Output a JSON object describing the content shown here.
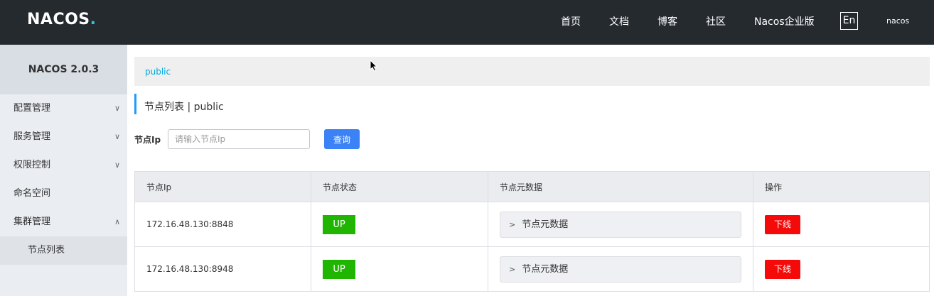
{
  "header": {
    "logo": "NACOS",
    "logo_dot": ".",
    "nav": [
      "首页",
      "文档",
      "博客",
      "社区",
      "Nacos企业版"
    ],
    "lang": "En",
    "user": "nacos"
  },
  "sidebar": {
    "title": "NACOS 2.0.3",
    "items": [
      {
        "label": "配置管理",
        "chevron": "∨"
      },
      {
        "label": "服务管理",
        "chevron": "∨"
      },
      {
        "label": "权限控制",
        "chevron": "∨"
      },
      {
        "label": "命名空间",
        "chevron": ""
      },
      {
        "label": "集群管理",
        "chevron": "∧"
      }
    ],
    "sub_items": [
      {
        "label": "节点列表"
      }
    ]
  },
  "breadcrumb": {
    "namespace": "public"
  },
  "page": {
    "title": "节点列表  |  public"
  },
  "search": {
    "label": "节点Ip",
    "placeholder": "请输入节点Ip",
    "value": "",
    "button": "查询"
  },
  "table": {
    "headers": [
      "节点Ip",
      "节点状态",
      "节点元数据",
      "操作"
    ],
    "rows": [
      {
        "ip": "172.16.48.130:8848",
        "status": "UP",
        "meta": "节点元数据",
        "action": "下线"
      },
      {
        "ip": "172.16.48.130:8948",
        "status": "UP",
        "meta": "节点元数据",
        "action": "下线"
      }
    ]
  },
  "colors": {
    "topbar": "#252a2f",
    "accent": "#209bfa",
    "up": "#1fb500",
    "offline": "#f50a0a",
    "link": "#00aadc"
  }
}
